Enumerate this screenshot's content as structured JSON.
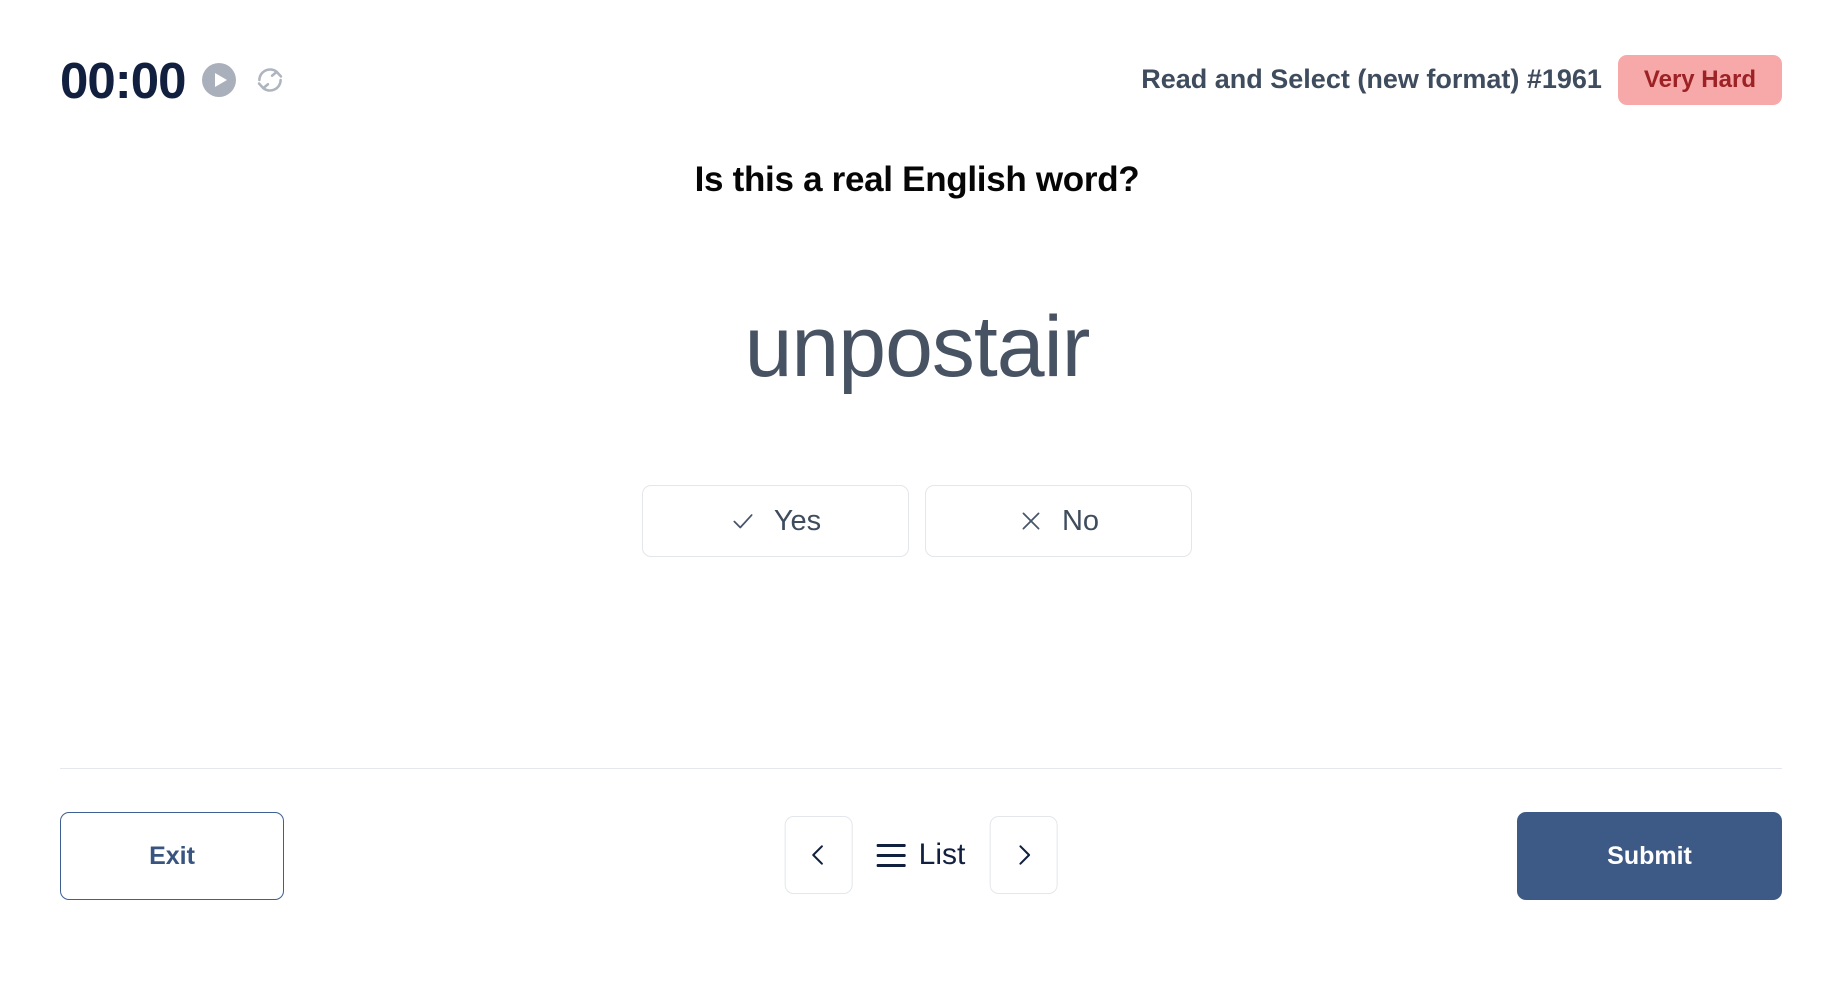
{
  "header": {
    "timer": "00:00",
    "play_icon": "play-circle-icon",
    "refresh_icon": "refresh-icon",
    "exercise_title": "Read and Select (new format) #1961",
    "difficulty": "Very Hard",
    "difficulty_bg": "#f7a8a8",
    "difficulty_color": "#9c2226"
  },
  "main": {
    "question": "Is this a real English word?",
    "word": "unpostair",
    "choices": [
      {
        "label": "Yes",
        "icon": "check-icon"
      },
      {
        "label": "No",
        "icon": "close-icon"
      }
    ]
  },
  "footer": {
    "exit_label": "Exit",
    "prev_icon": "chevron-left-icon",
    "next_icon": "chevron-right-icon",
    "list_label": "List",
    "list_icon": "hamburger-icon",
    "submit_label": "Submit",
    "submit_bg": "#3c5a85"
  }
}
